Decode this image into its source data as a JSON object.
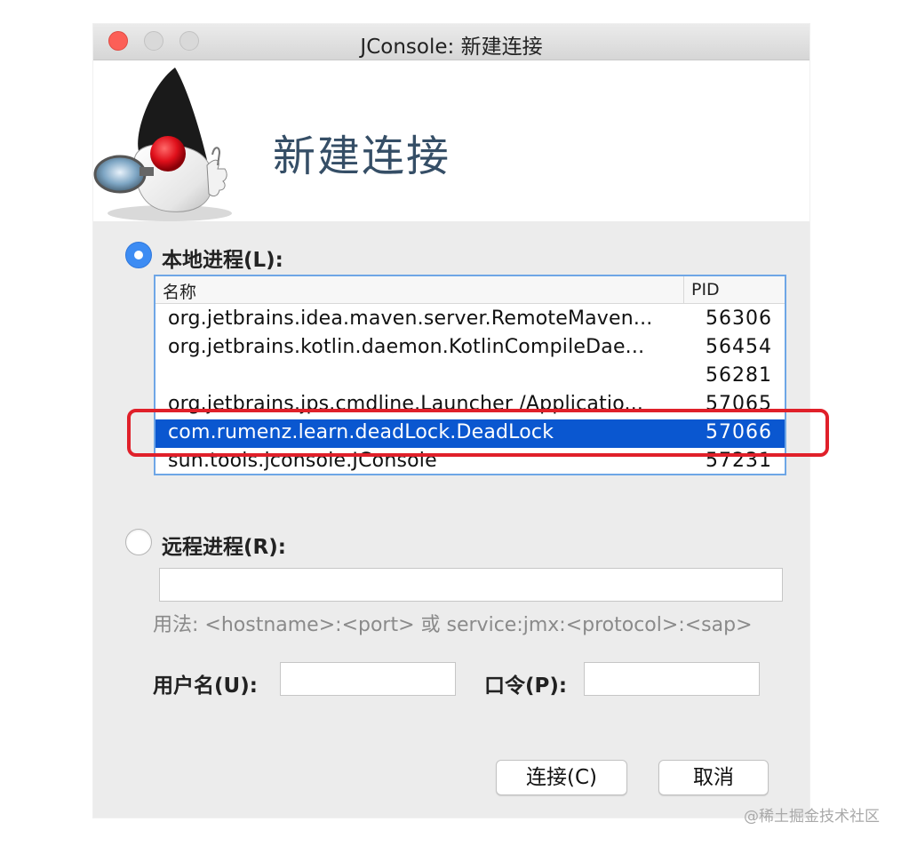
{
  "window": {
    "title": "JConsole: 新建连接"
  },
  "banner": {
    "title": "新建连接",
    "logo_icon": "duke-java-mascot-icon"
  },
  "local": {
    "label": "本地进程(L):",
    "selected": true,
    "table": {
      "headers": {
        "name": "名称",
        "pid": "PID"
      },
      "rows": [
        {
          "name": "org.jetbrains.idea.maven.server.RemoteMaven...",
          "pid": "56306"
        },
        {
          "name": "org.jetbrains.kotlin.daemon.KotlinCompileDae...",
          "pid": "56454"
        },
        {
          "name": "",
          "pid": "56281"
        },
        {
          "name": "org.jetbrains.jps.cmdline.Launcher /Applicatio...",
          "pid": "57065"
        },
        {
          "name": "com.rumenz.learn.deadLock.DeadLock",
          "pid": "57066"
        },
        {
          "name": "sun.tools.jconsole.JConsole",
          "pid": "57231"
        }
      ],
      "selected_row": 4
    },
    "annotation_color": "#e0202a"
  },
  "remote": {
    "label": "远程进程(R):",
    "selected": false,
    "input_value": "",
    "usage": "用法: <hostname>:<port> 或 service:jmx:<protocol>:<sap>"
  },
  "credentials": {
    "username_label": "用户名(U):",
    "username_value": "",
    "password_label": "口令(P):",
    "password_value": ""
  },
  "buttons": {
    "connect": "连接(C)",
    "cancel": "取消"
  },
  "watermark": "@稀土掘金技术社区",
  "colors": {
    "selection": "#0a57d0",
    "radio_accent": "#3d8cf3",
    "banner_title": "#354e66"
  }
}
